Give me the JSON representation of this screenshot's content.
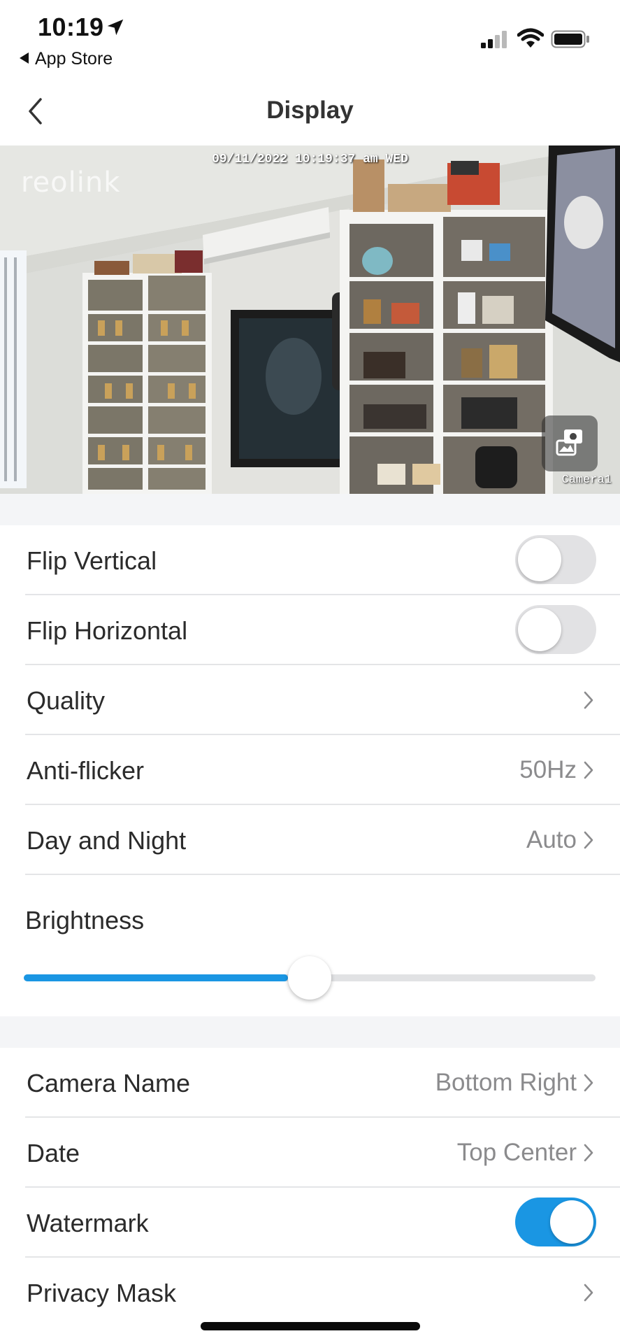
{
  "status_bar": {
    "time": "10:19",
    "back_app_label": "App Store",
    "icons": [
      "location-arrow-icon",
      "cellular-signal-icon",
      "wifi-icon",
      "battery-icon"
    ]
  },
  "nav": {
    "title": "Display",
    "back_icon": "chevron-left-icon"
  },
  "camera": {
    "timestamp": "09/11/2022 10:19:37 am WED",
    "logo": "reolink",
    "camera_name": "Camera1",
    "switch_icon": "camera-switch-icon"
  },
  "settings": {
    "flip_vertical": {
      "label": "Flip Vertical",
      "on": false
    },
    "flip_horizontal": {
      "label": "Flip Horizontal",
      "on": false
    },
    "quality": {
      "label": "Quality"
    },
    "anti_flicker": {
      "label": "Anti-flicker",
      "value": "50Hz"
    },
    "day_and_night": {
      "label": "Day and Night",
      "value": "Auto"
    },
    "brightness": {
      "label": "Brightness",
      "level": 0.5
    }
  },
  "overlay": {
    "camera_name": {
      "label": "Camera Name",
      "value": "Bottom Right"
    },
    "date": {
      "label": "Date",
      "value": "Top Center"
    },
    "watermark": {
      "label": "Watermark",
      "on": true
    },
    "privacy_mask": {
      "label": "Privacy Mask"
    }
  },
  "colors": {
    "accent": "#1a96e3",
    "toggle_off": "#e2e2e4",
    "background": "#f4f5f7",
    "value_text": "#8b8b8d"
  }
}
